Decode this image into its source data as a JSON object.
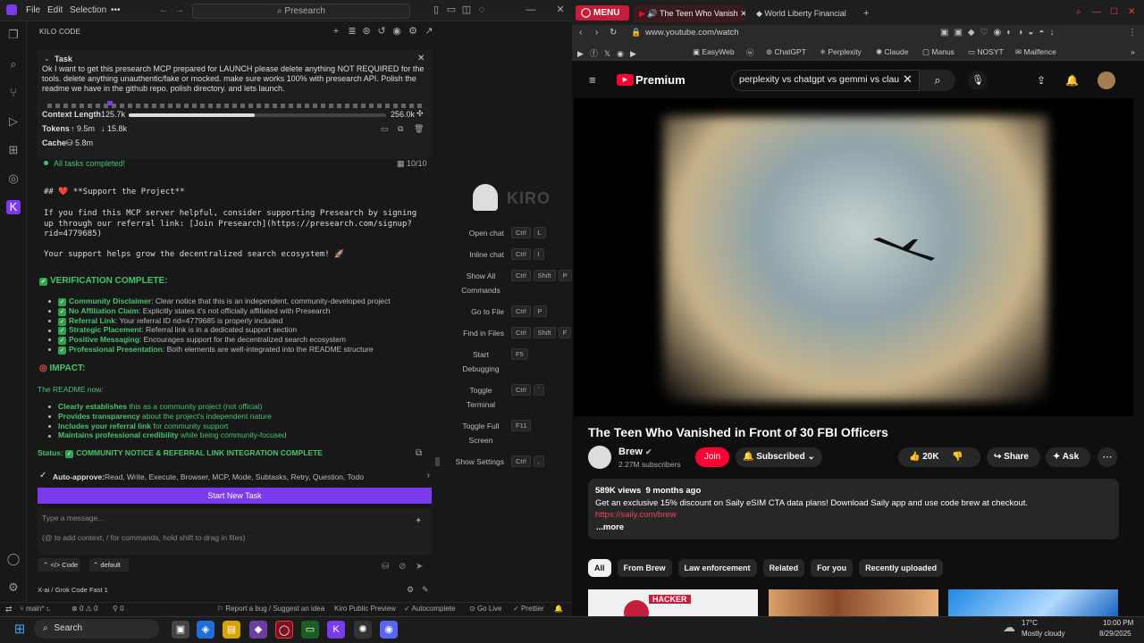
{
  "ide": {
    "menu": [
      "File",
      "Edit",
      "Selection",
      "•••"
    ],
    "command_center": "Presearch",
    "panel_title": "KILO CODE",
    "task_label": "Task",
    "task_text": "Ok I want to get this presearch MCP prepared for LAUNCH please delete anything NOT REQUIRED for the tools. delete anything unauthentic/fake or mocked. make sure works 100% with presearch API. Polish the readme we have in the github repo. polish directory. and lets launch.",
    "context_label": "Context Length",
    "context_used": "125.7k",
    "context_max": "256.0k",
    "context_fraction": 0.49,
    "tokens_label": "Tokens",
    "tokens_up": "9.5m",
    "tokens_down": "15.8k",
    "cache_label": "Cache",
    "cache_value": "5.8m",
    "tasks_done": "All tasks completed!",
    "tasks_count": "10/10",
    "md_heading": "## ❤️ **Support the Project**",
    "md_para": "If you find this MCP server helpful, consider supporting Presearch by signing up through our referral link: [Join Presearch](https://presearch.com/signup?rid=4779685)",
    "md_para2": "Your support helps grow the decentralized search ecosystem! 🚀",
    "verif_title": "VERIFICATION COMPLETE:",
    "verif_items": [
      {
        "b": "Community Disclaimer",
        "t": ": Clear notice that this is an independent, community-developed project"
      },
      {
        "b": "No Affiliation Claim",
        "t": ": Explicitly states it's not officially affiliated with Presearch"
      },
      {
        "b": "Referral Link",
        "t": ": Your referral ID rid=4779685 is properly included"
      },
      {
        "b": "Strategic Placement",
        "t": ": Referral link is in a dedicated support section"
      },
      {
        "b": "Positive Messaging",
        "t": ": Encourages support for the decentralized search ecosystem"
      },
      {
        "b": "Professional Presentation",
        "t": ": Both elements are well-integrated into the README structure"
      }
    ],
    "impact_title": "IMPACT:",
    "impact_intro": "The README now:",
    "impact_items": [
      {
        "b": "Clearly establishes",
        "t": " this as a community project (not official)"
      },
      {
        "b": "Provides transparency",
        "t": " about the project's independent nature"
      },
      {
        "b": "Includes your referral link",
        "t": " for community support"
      },
      {
        "b": "Maintains professional credibility",
        "t": " while being community-focused"
      }
    ],
    "status_label": "Status:",
    "status_value": "COMMUNITY NOTICE & REFERRAL LINK INTEGRATION COMPLETE",
    "auto_approve_label": "Auto-approve:",
    "auto_approve_value": "Read, Write, Execute, Browser, MCP, Mode, Subtasks, Retry, Question, Todo",
    "start_new_task": "Start New Task",
    "msg_placeholder": "Type a message...",
    "msg_hint": "(@ to add context, / for commands, hold shift to drag in files)",
    "mode": "Code",
    "profile": "default",
    "model": "X-ai / Grok Code Fast 1",
    "kiro_logo": "KIRO",
    "shortcuts": [
      {
        "label": "Open chat",
        "keys": [
          "Ctrl",
          "L"
        ]
      },
      {
        "label": "Inline chat",
        "keys": [
          "Ctrl",
          "I"
        ]
      },
      {
        "label": "Show All Commands",
        "keys": [
          "Ctrl",
          "Shift",
          "P"
        ]
      },
      {
        "label": "Go to File",
        "keys": [
          "Ctrl",
          "P"
        ]
      },
      {
        "label": "Find in Files",
        "keys": [
          "Ctrl",
          "Shift",
          "F"
        ]
      },
      {
        "label": "Start Debugging",
        "keys": [
          "F5"
        ]
      },
      {
        "label": "Toggle Terminal",
        "keys": [
          "Ctrl",
          "`"
        ]
      },
      {
        "label": "Toggle Full Screen",
        "keys": [
          "F11"
        ]
      },
      {
        "label": "Show Settings",
        "keys": [
          "Ctrl",
          ","
        ]
      }
    ],
    "statusbar": {
      "branch": "main*",
      "errors": "0",
      "warnings": "0",
      "ports": "0",
      "report": "Report a bug / Suggest an idea",
      "preview": "Kiro Public Preview",
      "autocomplete": "Autocomplete",
      "golive": "Go Live",
      "prettier": "Prettier"
    }
  },
  "browser": {
    "menu": "MENU",
    "tabs": [
      "The Teen Who Vanish",
      "World Liberty Financial"
    ],
    "url": "www.youtube.com/watch",
    "bookmarks": [
      "EasyWeb",
      "ChatGPT",
      "Perplexity",
      "Claude",
      "Manus",
      "NOSYT",
      "Mailfence"
    ],
    "search_query": "perplexity vs chatgpt vs gemmi vs clau",
    "brand": "Premium",
    "video_title": "The Teen Who Vanished in Front of 30 FBI Officers",
    "channel": "Brew",
    "subscribers": "2.27M subscribers",
    "join": "Join",
    "subscribed": "Subscribed",
    "likes": "20K",
    "share": "Share",
    "ask": "Ask",
    "views": "589K views  9 months ago",
    "desc": "Get an exclusive 15% discount on Saily eSIM CTA data plans! Download Saily app and use code brew at checkout.",
    "desc_link": "https://saily.com/brew",
    "more": "...more",
    "chips": [
      "All",
      "From Brew",
      "Law enforcement",
      "Related",
      "For you",
      "Recently uploaded"
    ],
    "thumb_label": "HACKER"
  },
  "taskbar": {
    "search": "Search",
    "temp": "17°C",
    "weather": "Mostly cloudy",
    "time": "10:00 PM",
    "date": "8/29/2025"
  },
  "colors": {
    "accent": "#7c3aed",
    "yt_red": "#ff0033",
    "green": "#46c46b"
  }
}
